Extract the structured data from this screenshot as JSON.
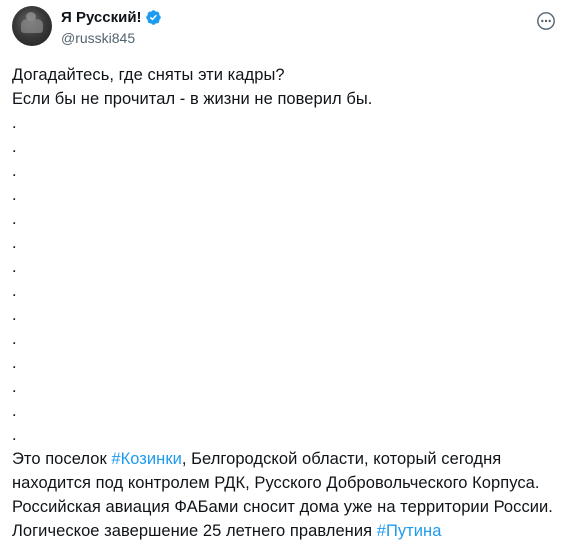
{
  "author": {
    "display_name": "Я Русский!",
    "handle": "@russki845",
    "verified_color": "#1d9bf0"
  },
  "icons": {
    "avatar": "avatar-image",
    "verified": "verified-badge-icon",
    "more": "more-options-icon"
  },
  "tweet": {
    "line1": "Догадайтесь, где сняты эти кадры?",
    "line2": "Если бы не прочитал - в жизни не поверил бы.",
    "dots": [
      ".",
      ".",
      ".",
      ".",
      ".",
      ".",
      ".",
      ".",
      ".",
      ".",
      ".",
      ".",
      ".",
      "."
    ],
    "p1_before": "Это поселок ",
    "p1_hashtag": "#Козинки",
    "p1_after": ", Белгородской области, который сегодня",
    "p2": "находится под контролем РДК, Русского Добровольческого Корпуса.",
    "p3": "Российская авиация ФАБами сносит дома уже на территории России.",
    "p4_before": "Логическое завершение 25 летнего правления ",
    "p4_hashtag": "#Путина"
  },
  "colors": {
    "text": "#0f1419",
    "secondary": "#536471",
    "link": "#1d9bf0"
  }
}
